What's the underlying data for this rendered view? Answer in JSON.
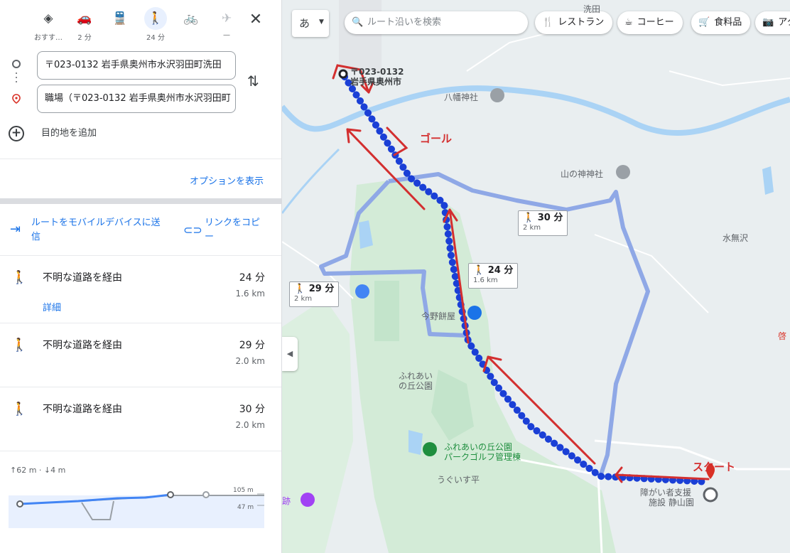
{
  "modes": [
    {
      "name": "best-mode",
      "icon": "◈",
      "label": "おすす…"
    },
    {
      "name": "car-mode",
      "icon": "🚗",
      "label": "2 分"
    },
    {
      "name": "transit-mode",
      "icon": "🚆",
      "label": ""
    },
    {
      "name": "walk-mode",
      "icon": "🚶",
      "label": "24 分"
    },
    {
      "name": "bike-mode",
      "icon": "🚲",
      "label": ""
    },
    {
      "name": "flight-mode",
      "icon": "✈",
      "label": "—"
    }
  ],
  "close_icon": "✕",
  "origin_value": "〒023-0132 岩手県奥州市水沢羽田町洗田",
  "destination_value": "職場（〒023-0132 岩手県奥州市水沢羽田町",
  "add_destination": "目的地を追加",
  "options_link": "オプションを表示",
  "send_to_device": "ルートをモバイルデバイスに送信",
  "copy_link": "リンクをコピー",
  "routes": [
    {
      "via": "不明な道路を経由",
      "duration": "24 分",
      "distance": "1.6 km",
      "detail": "詳細"
    },
    {
      "via": "不明な道路を経由",
      "duration": "29 分",
      "distance": "2.0 km",
      "detail": ""
    },
    {
      "via": "不明な道路を経由",
      "duration": "30 分",
      "distance": "2.0 km",
      "detail": ""
    }
  ],
  "elevation": {
    "summary": "↑62 m · ↓4 m",
    "max_label": "105 m",
    "min_label": "47 m"
  },
  "map": {
    "lang_button": "あ",
    "search_placeholder": "ルート沿いを検索",
    "chips": [
      "レストラン",
      "コーヒー",
      "食料品",
      "アク"
    ],
    "labels": {
      "origin_postal": "〒023-0132",
      "origin_city": "岩手県奥州市",
      "hachiman": "八幡神社",
      "yamanokami": "山の神神社",
      "mizunashi": "水無沢",
      "imano": "今野餅屋",
      "fureai_oka_1": "ふれあい",
      "fureai_oka_2": "の丘公園",
      "park_golf_1": "ふれあいの丘公園",
      "park_golf_2": "パークゴルフ管理棟",
      "uguisu": "うぐいす平",
      "facility_1": "障がい者支援",
      "facility_2": "施設 静山園",
      "senda": "洗田",
      "keito": "啓",
      "iseki": "跡"
    },
    "annotations": {
      "goal": "ゴール",
      "start": "スタート"
    },
    "bubbles": [
      {
        "time": "30 分",
        "dist": "2 km"
      },
      {
        "time": "24 分",
        "dist": "1.6 km"
      },
      {
        "time": "29 分",
        "dist": "2 km"
      }
    ]
  }
}
